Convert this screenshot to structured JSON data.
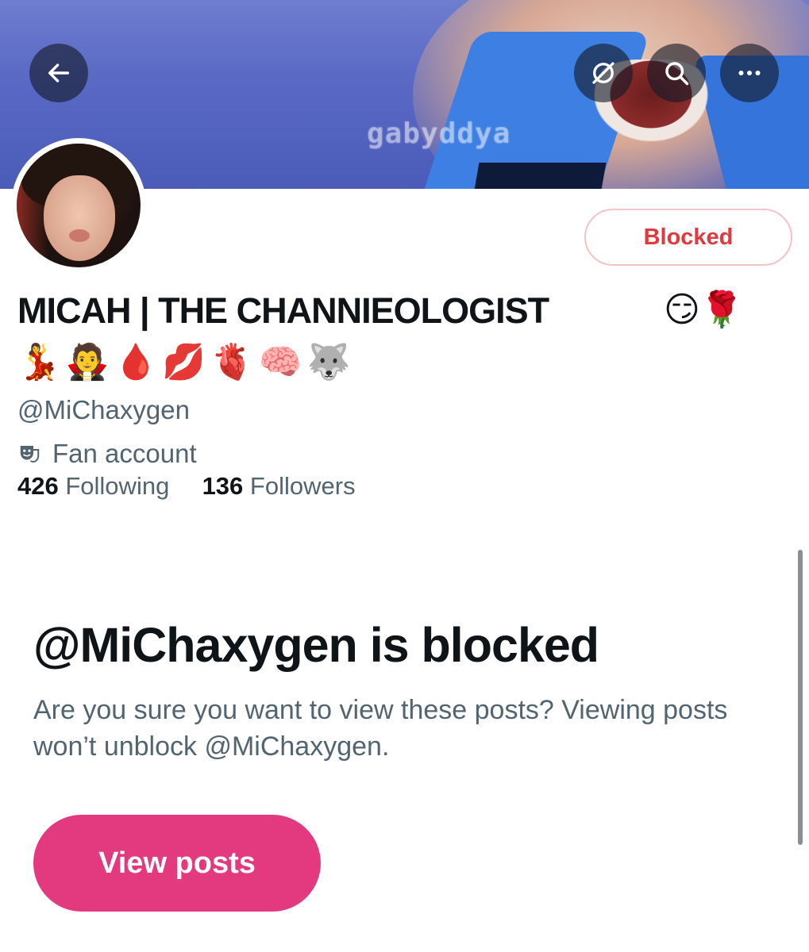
{
  "banner": {
    "watermark": "gabyddya"
  },
  "header": {
    "back_icon": "arrow-left-icon",
    "grok_icon": "grok-icon",
    "search_icon": "search-icon",
    "more_icon": "more-horizontal-icon"
  },
  "profile": {
    "blocked_button_label": "Blocked",
    "display_name": "MICAH | THE CHANNIEOLOGIST",
    "name_emojis": "😏🌹",
    "bio_emojis": "💃🧛🩸💋🫀🧠🐺",
    "handle": "@MiChaxygen",
    "category_icon": "theater-masks-icon",
    "category": "Fan account",
    "following_count": "426",
    "following_label": "Following",
    "followers_count": "136",
    "followers_label": "Followers"
  },
  "notice": {
    "title": "@MiChaxygen is blocked",
    "description": "Are you sure you want to view these posts? Viewing posts won’t unblock @MiChaxygen.",
    "button_label": "View posts"
  },
  "colors": {
    "blocked_red": "#e0393e",
    "view_posts_pink": "#e2397f",
    "secondary_text": "#536471"
  }
}
